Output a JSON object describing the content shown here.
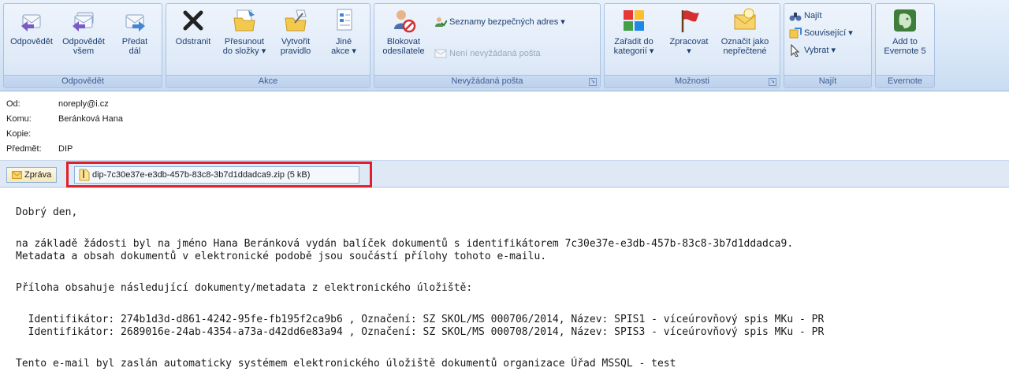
{
  "ribbon": {
    "groups": [
      {
        "label": "Odpovědět"
      },
      {
        "label": "Akce"
      },
      {
        "label": "Nevyžádaná pošta"
      },
      {
        "label": "Možnosti"
      },
      {
        "label": "Najít"
      },
      {
        "label": "Evernote"
      }
    ],
    "reply": {
      "line1": "Odpovědět",
      "line2": ""
    },
    "reply_all": {
      "line1": "Odpovědět",
      "line2": "všem"
    },
    "forward": {
      "line1": "Předat",
      "line2": "dál"
    },
    "delete": {
      "line1": "Odstranit",
      "line2": ""
    },
    "move": {
      "line1": "Přesunout",
      "line2": "do složky ▾"
    },
    "create_rule": {
      "line1": "Vytvořit",
      "line2": "pravidlo"
    },
    "other_actions": {
      "line1": "Jiné",
      "line2": "akce ▾"
    },
    "block_sender": {
      "line1": "Blokovat",
      "line2": "odesílatele"
    },
    "safe_lists": "Seznamy bezpečných adres ▾",
    "not_junk": "Není nevyžádaná pošta",
    "categorize": {
      "line1": "Zařadit do",
      "line2": "kategorií ▾"
    },
    "follow_up": {
      "line1": "Zpracovat",
      "line2": "▾"
    },
    "mark_unread": {
      "line1": "Označit jako",
      "line2": "nepřečtené"
    },
    "find": "Najít",
    "related": "Související ▾",
    "select": "Vybrat ▾",
    "evernote": {
      "line1": "Add to",
      "line2": "Evernote 5"
    }
  },
  "header": {
    "from_label": "Od:",
    "from_value": "noreply@i.cz",
    "to_label": "Komu:",
    "to_value": "Beránková Hana",
    "cc_label": "Kopie:",
    "cc_value": "",
    "subject_label": "Předmět:",
    "subject_value": "DIP"
  },
  "attachments": {
    "message_tab": "Zpráva",
    "file": "dip-7c30e37e-e3db-457b-83c8-3b7d1ddadca9.zip (5 kB)"
  },
  "body": {
    "greeting": "Dobrý den,",
    "para1_line1": "na základě žádosti byl na jméno Hana Beránková vydán balíček dokumentů s identifikátorem 7c30e37e-e3db-457b-83c8-3b7d1ddadca9.",
    "para1_line2": "Metadata a obsah dokumentů v elektronické podobě jsou součástí přílohy tohoto e-mailu.",
    "para2": "Příloha obsahuje následující dokumenty/metadata z elektronického úložiště:",
    "doc1": "  Identifikátor: 274b1d3d-d861-4242-95fe-fb195f2ca9b6 , Označení: SZ SKOL/MS 000706/2014, Název: SPIS1 - víceúrovňový spis MKu - PR",
    "doc2": "  Identifikátor: 2689016e-24ab-4354-a73a-d42dd6e83a94 , Označení: SZ SKOL/MS 000708/2014, Název: SPIS3 - víceúrovňový spis MKu - PR",
    "footer": "Tento e-mail byl zaslán automaticky systémem elektronického úložiště dokumentů organizace Úřad MSSQL - test"
  }
}
